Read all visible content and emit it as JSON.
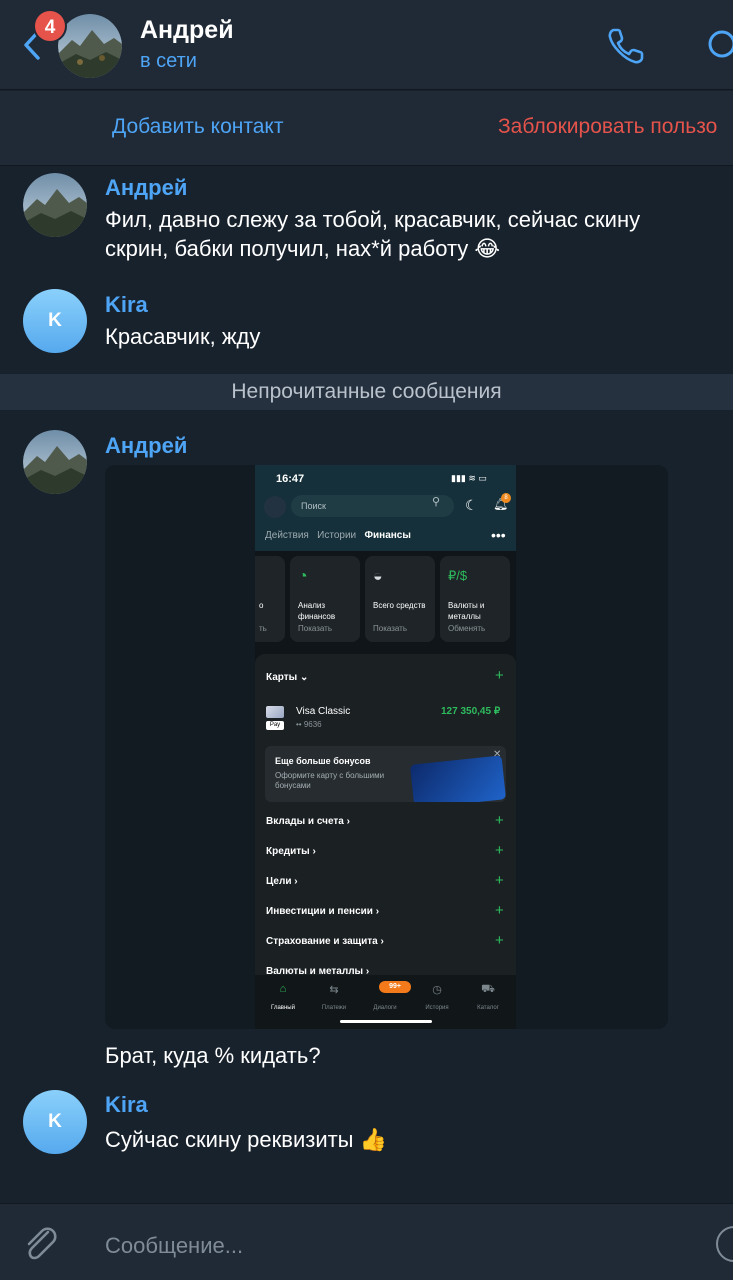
{
  "header": {
    "back_badge": "4",
    "title": "Андрей",
    "status": "в сети"
  },
  "actions": {
    "add_contact": "Добавить контакт",
    "block_user": "Заблокировать пользо"
  },
  "messages": [
    {
      "sender": "Андрей",
      "text1": "Фил, давно слежу за тобой, красавчик, сейчас скину",
      "text2": "скрин, бабки получил, нах*й работу 😂"
    },
    {
      "sender": "Kira",
      "avatar_letter": "K",
      "text": "Красавчик, жду"
    },
    {
      "sender": "Андрей",
      "caption": "Брат, куда % кидать?"
    },
    {
      "sender": "Kira",
      "avatar_letter": "K",
      "text": "Суйчас скину реквизиты 👍"
    }
  ],
  "unread_divider": "Непрочитанные сообщения",
  "screenshot": {
    "time": "16:47",
    "search_placeholder": "Поиск",
    "bell_badge": "8",
    "tabs": [
      "Действия",
      "Истории",
      "Финансы"
    ],
    "tiles": [
      {
        "title": "о",
        "sub": "ть"
      },
      {
        "title": "Анализ финансов",
        "sub": "Показать"
      },
      {
        "title": "Всего средств",
        "sub": "Показать"
      },
      {
        "title": "Валюты и металлы",
        "sub": "Обменять"
      }
    ],
    "cards_label": "Карты ⌄",
    "card_name": "Visa Classic",
    "card_num": "•• 9636",
    "card_amount": "127 350,45 ₽",
    "pay_label": "Pay",
    "promo_title": "Еще больше бонусов",
    "promo_sub": "Оформите карту с большими бонусами",
    "sections": [
      "Вклады и счета ›",
      "Кредиты ›",
      "Цели ›",
      "Инвестиции и пенсии ›",
      "Страхование и защита ›",
      "Валюты и металлы ›"
    ],
    "nav": [
      "Главный",
      "Платежи",
      "Диалоги",
      "История",
      "Каталог"
    ],
    "nav_badge": "99+"
  },
  "composer": {
    "placeholder": "Сообщение..."
  },
  "colors": {
    "background": "#18222d",
    "panel": "#1f2a36",
    "accent": "#4ea4f5",
    "danger": "#e5534b",
    "green": "#2ebb5d"
  },
  "icons": [
    "back-chevron-icon",
    "phone-icon",
    "search-icon",
    "paperclip-icon",
    "emoji-icon"
  ]
}
